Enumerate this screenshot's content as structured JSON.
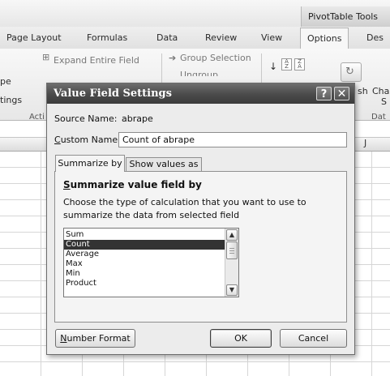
{
  "ribbon": {
    "contextual_label": "PivotTable Tools",
    "tabs": [
      "Page Layout",
      "Formulas",
      "Data",
      "Review",
      "View",
      "Options",
      "Des"
    ],
    "active_tab": "Options",
    "expand_entire_field": "Expand Entire Field",
    "group_selection": "Group Selection",
    "ungroup_partial": "Ungroup",
    "left_clip_1": "pe",
    "left_clip_2": "tings",
    "left_group_clip": "Acti",
    "refresh_clip": "sh",
    "change_clip_1": "Cha",
    "change_clip_2": "S",
    "data_group_clip": "Dat",
    "sort_az": "A Z",
    "sort_za": "Z A"
  },
  "sheet": {
    "visible_column": "J"
  },
  "dialog": {
    "title": "Value Field Settings",
    "help_glyph": "?",
    "close_glyph": "✕",
    "source_name_label": "Source Name:",
    "source_name_value": "abrape",
    "custom_name_label_u": "C",
    "custom_name_label_rest": "ustom Name:",
    "custom_name_value": "Count of abrape",
    "tabs": {
      "summarize": "Summarize by",
      "show_values": "Show values as"
    },
    "section_heading_u": "S",
    "section_heading_rest": "ummarize value field by",
    "description": "Choose the type of calculation that you want to use to summarize the data from selected field",
    "functions": [
      "Sum",
      "Count",
      "Average",
      "Max",
      "Min",
      "Product"
    ],
    "selected_function": "Count",
    "buttons": {
      "number_format_u": "N",
      "number_format_rest": "umber Format",
      "ok": "OK",
      "cancel": "Cancel"
    }
  }
}
